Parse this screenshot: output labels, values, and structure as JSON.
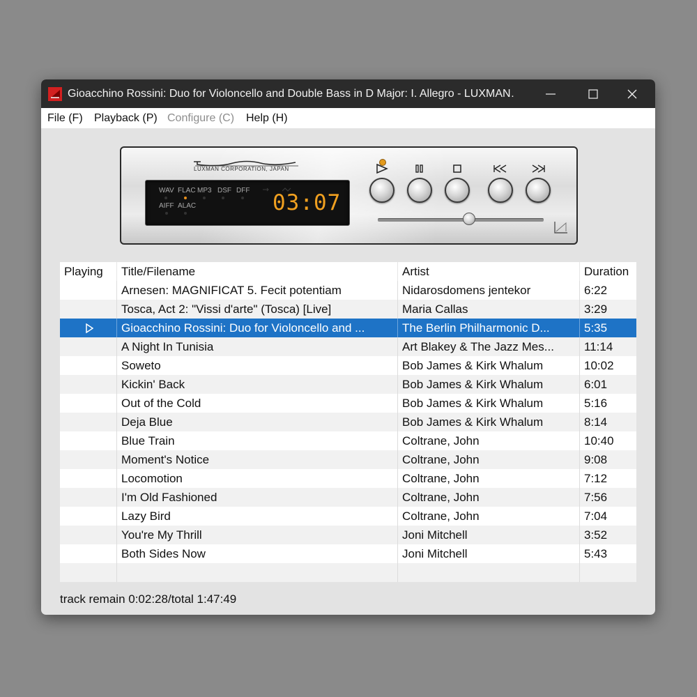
{
  "window": {
    "title": "Gioacchino Rossini: Duo for Violoncello and Double Bass in D Major: I. Allegro - LUXMAN…"
  },
  "menu": [
    {
      "label": "File (F)",
      "enabled": true
    },
    {
      "label": "Playback (P)",
      "enabled": true
    },
    {
      "label": "Configure (C)",
      "enabled": false
    },
    {
      "label": "Help (H)",
      "enabled": true
    }
  ],
  "deck": {
    "logo": "LUXMAN",
    "corporation": "LUXMAN CORPORATION, JAPAN",
    "formats_row1": [
      "WAV",
      "FLAC",
      "MP3",
      "DSF",
      "DFF"
    ],
    "formats_row2": [
      "AIFF",
      "ALAC"
    ],
    "active_format": "FLAC",
    "time": "03:07",
    "controls": [
      "play",
      "pause",
      "stop",
      "previous",
      "next"
    ],
    "seek_position": 0.55
  },
  "playlist": {
    "columns": [
      "Playing",
      "Title/Filename",
      "Artist",
      "Duration"
    ],
    "rows": [
      {
        "playing": false,
        "title": "Arnesen: MAGNIFICAT 5. Fecit potentiam",
        "artist": "Nidarosdomens jentekor",
        "duration": "6:22"
      },
      {
        "playing": false,
        "title": "Tosca, Act 2: \"Vissi d'arte\" (Tosca) [Live]",
        "artist": "Maria Callas",
        "duration": "3:29"
      },
      {
        "playing": true,
        "title": "Gioacchino Rossini: Duo for Violoncello and ...",
        "artist": "The Berlin Philharmonic D...",
        "duration": "5:35"
      },
      {
        "playing": false,
        "title": "A Night In Tunisia",
        "artist": "Art Blakey & The Jazz Mes...",
        "duration": "11:14"
      },
      {
        "playing": false,
        "title": "Soweto",
        "artist": "Bob James & Kirk Whalum",
        "duration": "10:02"
      },
      {
        "playing": false,
        "title": "Kickin' Back",
        "artist": "Bob James & Kirk Whalum",
        "duration": "6:01"
      },
      {
        "playing": false,
        "title": "Out of the Cold",
        "artist": "Bob James & Kirk Whalum",
        "duration": "5:16"
      },
      {
        "playing": false,
        "title": "Deja Blue",
        "artist": "Bob James & Kirk Whalum",
        "duration": "8:14"
      },
      {
        "playing": false,
        "title": "Blue Train",
        "artist": "Coltrane, John",
        "duration": "10:40"
      },
      {
        "playing": false,
        "title": "Moment's Notice",
        "artist": "Coltrane, John",
        "duration": "9:08"
      },
      {
        "playing": false,
        "title": "Locomotion",
        "artist": "Coltrane, John",
        "duration": "7:12"
      },
      {
        "playing": false,
        "title": "I'm Old Fashioned",
        "artist": "Coltrane, John",
        "duration": "7:56"
      },
      {
        "playing": false,
        "title": "Lazy Bird",
        "artist": "Coltrane, John",
        "duration": "7:04"
      },
      {
        "playing": false,
        "title": "You're My Thrill",
        "artist": "Joni Mitchell",
        "duration": "3:52"
      },
      {
        "playing": false,
        "title": "Both Sides Now",
        "artist": "Joni Mitchell",
        "duration": "5:43"
      }
    ]
  },
  "status": {
    "text": "track remain 0:02:28/total 1:47:49"
  },
  "colors": {
    "selection": "#1e73c6",
    "titlebar": "#2b2b2b",
    "display_time": "#f0a020",
    "led": "#e39a1c"
  }
}
